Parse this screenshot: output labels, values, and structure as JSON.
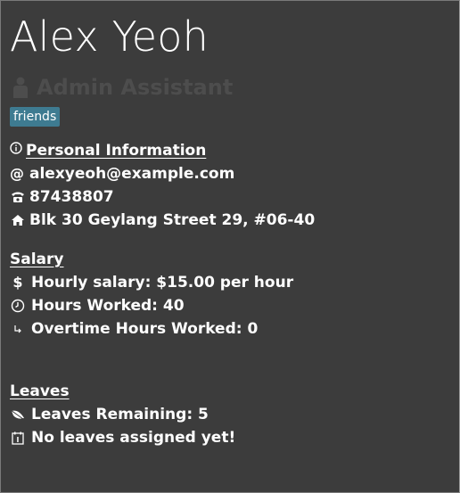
{
  "person": {
    "name": "Alex Yeoh",
    "role": "Admin Assistant",
    "tags": [
      "friends"
    ]
  },
  "personal_info": {
    "heading": "Personal Information",
    "email_icon_glyph": "@",
    "email": "alexyeoh@example.com",
    "phone": "87438807",
    "address": "Blk 30 Geylang Street 29, #06-40"
  },
  "salary": {
    "heading": "Salary",
    "currency_icon_glyph": "$",
    "hourly": "Hourly salary: $15.00 per hour",
    "hours": "Hours Worked: 40",
    "overtime": "Overtime Hours Worked: 0"
  },
  "leaves": {
    "heading": "Leaves",
    "remaining": "Leaves Remaining: 5",
    "assigned": "No leaves assigned yet!"
  },
  "colors": {
    "background": "#3c3c3c",
    "tag_bg": "#3e7b91",
    "role_text": "#4d4d4d",
    "text": "#ffffff"
  },
  "icons": [
    "person-icon",
    "info-icon",
    "at-icon",
    "phone-icon",
    "home-icon",
    "dollar-icon",
    "clock-icon",
    "arrow-icon",
    "leaf-icon",
    "calendar-icon"
  ]
}
